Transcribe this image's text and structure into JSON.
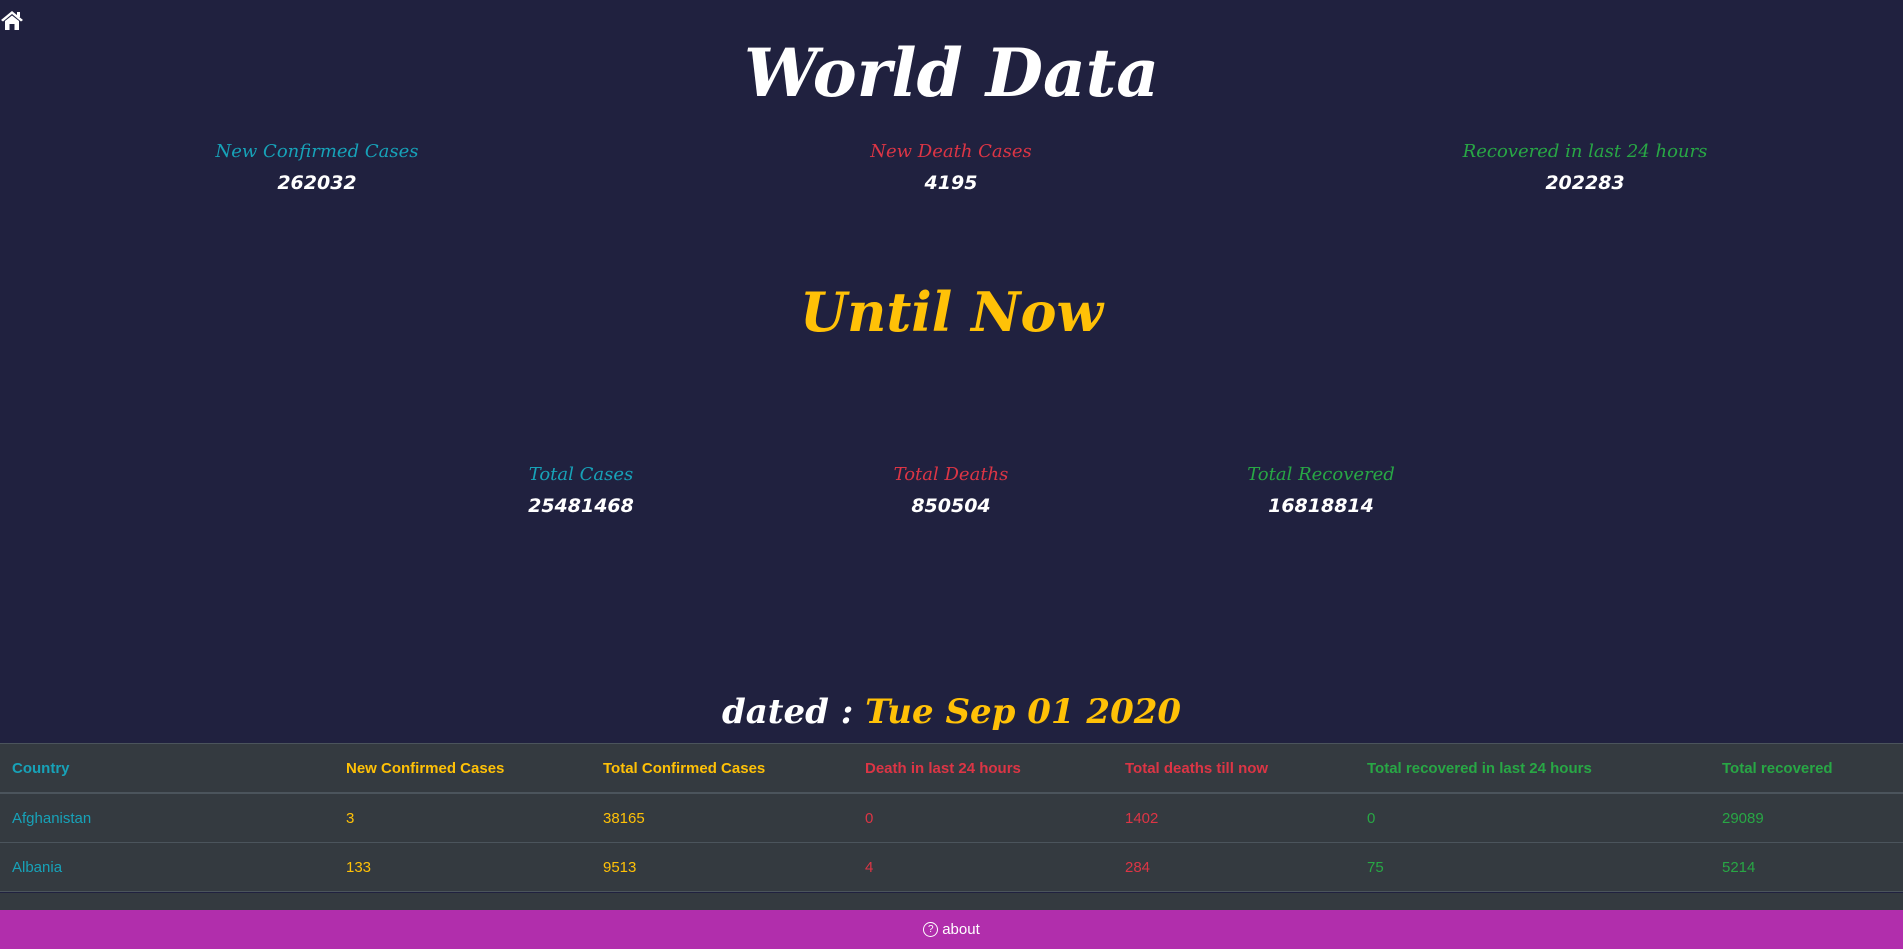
{
  "nav": {
    "home_icon": "home-icon"
  },
  "header": {
    "title": "World Data"
  },
  "daily": [
    {
      "label": "New Confirmed Cases",
      "value": "262032",
      "color": "#17a2b8"
    },
    {
      "label": "New Death Cases",
      "value": "4195",
      "color": "#dc3545"
    },
    {
      "label": "Recovered in last 24 hours",
      "value": "202283",
      "color": "#28a745"
    }
  ],
  "totals_title": "Until Now",
  "totals": [
    {
      "label": "Total Cases",
      "value": "25481468",
      "color": "#17a2b8"
    },
    {
      "label": "Total Deaths",
      "value": "850504",
      "color": "#dc3545"
    },
    {
      "label": "Total Recovered",
      "value": "16818814",
      "color": "#28a745"
    }
  ],
  "dated": {
    "prefix": "dated :",
    "date": "Tue Sep 01 2020"
  },
  "table": {
    "headers": [
      "Country",
      "New Confirmed Cases",
      "Total Confirmed Cases",
      "Death in last 24 hours",
      "Total deaths till now",
      "Total recovered in last 24 hours",
      "Total recovered"
    ],
    "rows": [
      [
        "Afghanistan",
        "3",
        "38165",
        "0",
        "1402",
        "0",
        "29089"
      ],
      [
        "Albania",
        "133",
        "9513",
        "4",
        "284",
        "75",
        "5214"
      ]
    ]
  },
  "footer": {
    "icon": "question-circle-icon",
    "label": "about"
  },
  "colors": {
    "background": "#20213f",
    "table": "#343a40",
    "footer": "#b12eac"
  }
}
